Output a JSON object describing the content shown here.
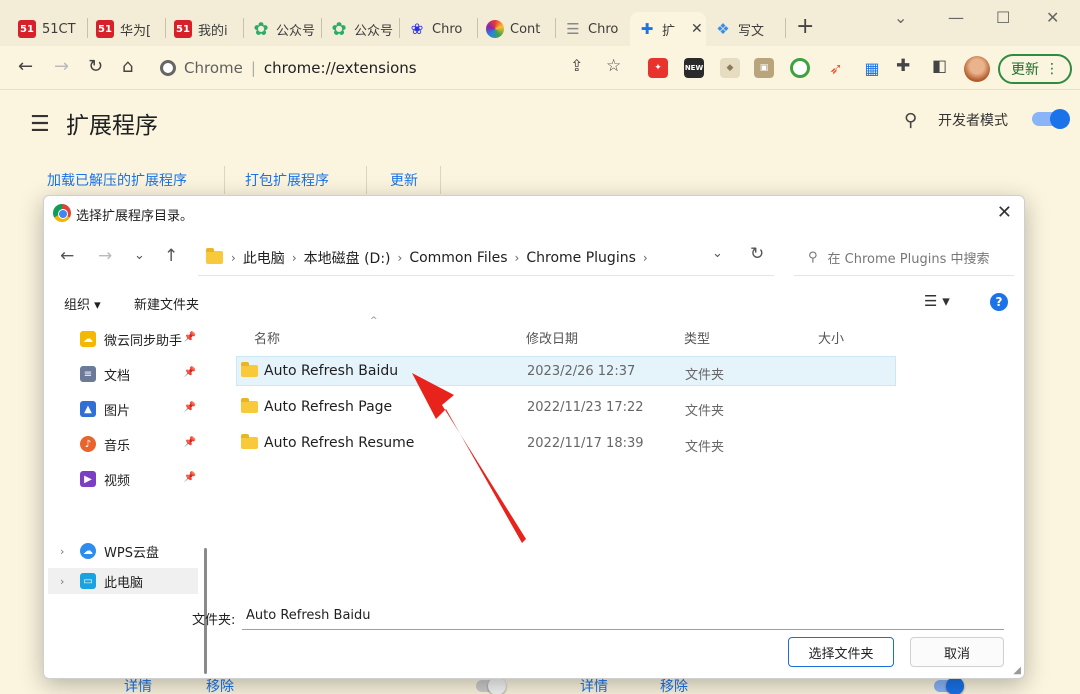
{
  "tabs": [
    {
      "label": "51CT",
      "icon": "51cto-icon"
    },
    {
      "label": "华为[",
      "icon": "51cto-icon"
    },
    {
      "label": "我的i",
      "icon": "51cto-icon"
    },
    {
      "label": "公众号",
      "icon": "wechat-icon"
    },
    {
      "label": "公众号",
      "icon": "wechat-icon"
    },
    {
      "label": "Chro",
      "icon": "baidu-paw-icon"
    },
    {
      "label": "Cont",
      "icon": "color-wheel-icon"
    },
    {
      "label": "Chro",
      "icon": "document-icon"
    },
    {
      "label": "扩",
      "icon": "puzzle-icon"
    },
    {
      "label": "写文",
      "icon": "write-icon"
    }
  ],
  "toolbar": {
    "site_name": "Chrome",
    "url": "chrome://extensions",
    "update_button": "更新"
  },
  "extensions_page": {
    "title": "扩展程序",
    "developer_mode_label": "开发者模式",
    "actions": [
      "加载已解压的扩展程序",
      "打包扩展程序",
      "更新"
    ],
    "card_buttons": [
      "详情",
      "移除",
      "详情",
      "移除"
    ]
  },
  "dialog": {
    "title": "选择扩展程序目录。",
    "breadcrumb": [
      "此电脑",
      "本地磁盘 (D:)",
      "Common Files",
      "Chrome Plugins"
    ],
    "search_placeholder": "在 Chrome Plugins 中搜索",
    "organize_label": "组织 ▾",
    "new_folder_label": "新建文件夹",
    "nav_items": [
      {
        "label": "微云同步助手",
        "icon": "weiyun-icon",
        "color": "#f5b800"
      },
      {
        "label": "文档",
        "icon": "documents-icon",
        "color": "#6b7a99"
      },
      {
        "label": "图片",
        "icon": "pictures-icon",
        "color": "#2f6fd6"
      },
      {
        "label": "音乐",
        "icon": "music-icon",
        "color": "#e8642c"
      },
      {
        "label": "视频",
        "icon": "videos-icon",
        "color": "#7b3fc4"
      }
    ],
    "nav_groups": [
      {
        "label": "WPS云盘",
        "icon": "wps-cloud-icon"
      },
      {
        "label": "此电脑",
        "icon": "this-pc-icon"
      }
    ],
    "columns": {
      "name": "名称",
      "date": "修改日期",
      "type": "类型",
      "size": "大小"
    },
    "files": [
      {
        "name": "Auto Refresh Baidu",
        "date": "2023/2/26 12:37",
        "type": "文件夹",
        "selected": true
      },
      {
        "name": "Auto Refresh Page",
        "date": "2022/11/23 17:22",
        "type": "文件夹",
        "selected": false
      },
      {
        "name": "Auto Refresh Resume",
        "date": "2022/11/17 18:39",
        "type": "文件夹",
        "selected": false
      }
    ],
    "folder_label": "文件夹:",
    "folder_value": "Auto Refresh Baidu",
    "confirm_button": "选择文件夹",
    "cancel_button": "取消"
  },
  "colors": {
    "accent": "#1a73e8",
    "annotation_arrow": "#e8231c",
    "selection": "#e5f3fb"
  }
}
